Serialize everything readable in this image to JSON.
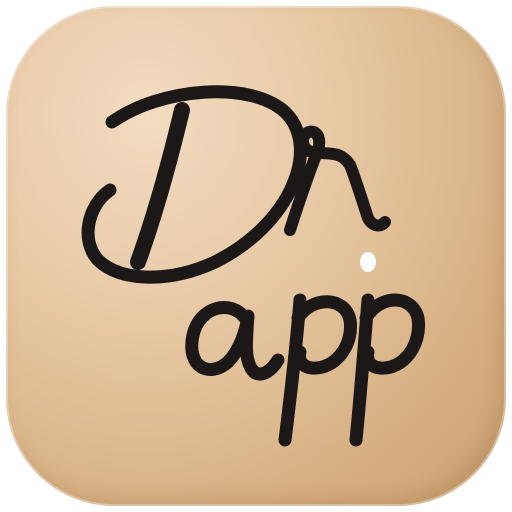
{
  "app_icon": {
    "logo_lettering": "Dr. app",
    "colors": {
      "background_light": "#f3dcc1",
      "background_dark": "#c99f6f",
      "ink": "#1c1817",
      "dot": "#ffffff"
    }
  }
}
